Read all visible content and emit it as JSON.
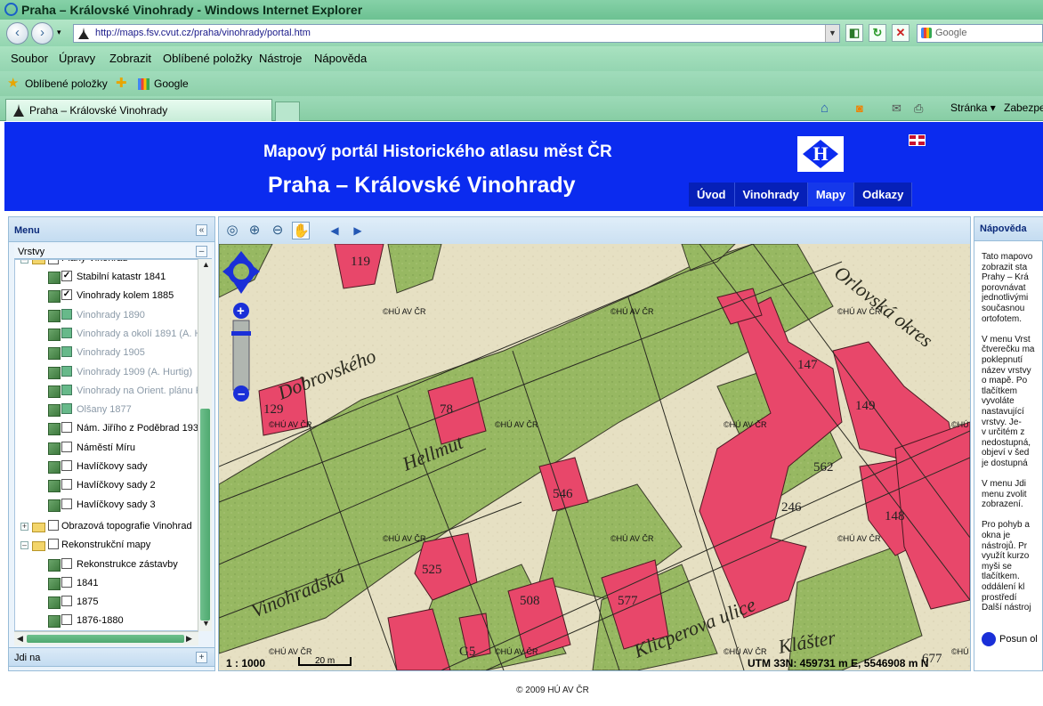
{
  "window": {
    "title": "Praha – Královské Vinohrady - Windows Internet Explorer"
  },
  "nav": {
    "url": "http://maps.fsv.cvut.cz/praha/vinohrady/portal.htm",
    "search_placeholder": "Google"
  },
  "menubar": [
    "Soubor",
    "Úpravy",
    "Zobrazit",
    "Oblíbené položky",
    "Nástroje",
    "Nápověda"
  ],
  "favbar": {
    "favorites": "Oblíbené položky",
    "google": "Google"
  },
  "tabbar": {
    "active_tab": "Praha – Královské Vinohrady",
    "page_menu": "Stránka",
    "safety_menu": "Zabezpe"
  },
  "page": {
    "title1": "Mapový portál Historického atlasu měst ČR",
    "title2": "Praha – Královské Vinohrady",
    "logo_letter": "H",
    "tabs": [
      {
        "label": "Úvod",
        "active": false
      },
      {
        "label": "Vinohrady",
        "active": false
      },
      {
        "label": "Mapy",
        "active": true
      },
      {
        "label": "Odkazy",
        "active": false
      }
    ],
    "footer": "© 2009 HÚ AV ČR"
  },
  "left": {
    "menu_title": "Menu",
    "collapse_btn": "«",
    "layers_title": "Vrstvy",
    "layers_btn": "–",
    "goto_title": "Jdi na",
    "goto_btn": "+",
    "top_partial": "Plány Vinohrad",
    "layers": [
      {
        "label": "Stabilní katastr 1841",
        "checked": true,
        "enabled": true
      },
      {
        "label": "Vinohrady kolem 1885",
        "checked": true,
        "enabled": true
      },
      {
        "label": "Vinohrady 1890",
        "checked": false,
        "enabled": false
      },
      {
        "label": "Vinohrady a okolí 1891 (A. H",
        "checked": false,
        "enabled": false
      },
      {
        "label": "Vinohrady 1905",
        "checked": false,
        "enabled": false
      },
      {
        "label": "Vinohrady 1909 (A. Hurtig)",
        "checked": false,
        "enabled": false
      },
      {
        "label": "Vinohrady na Orient. plánu P",
        "checked": false,
        "enabled": false
      },
      {
        "label": "Olšany 1877",
        "checked": false,
        "enabled": false
      },
      {
        "label": "Nám. Jiřího z Poděbrad 1932",
        "checked": false,
        "enabled": true
      },
      {
        "label": "Náměstí Míru",
        "checked": false,
        "enabled": true
      },
      {
        "label": "Havlíčkovy sady",
        "checked": false,
        "enabled": true
      },
      {
        "label": "Havlíčkovy sady 2",
        "checked": false,
        "enabled": true
      },
      {
        "label": "Havlíčkovy sady 3",
        "checked": false,
        "enabled": true
      }
    ],
    "groups": [
      {
        "label": "Obrazová topografie Vinohrad"
      },
      {
        "label": "Rekonstrukční mapy"
      }
    ],
    "recon_layers": [
      {
        "label": "Rekonstrukce zástavby"
      },
      {
        "label": "1841"
      },
      {
        "label": "1875"
      },
      {
        "label": "1876-1880"
      }
    ]
  },
  "map": {
    "watermark": "©HÚ AV ČR",
    "scale": "1 : 1000",
    "scale_bar": "20 m",
    "coords": "UTM 33N: 459731 m E, 5546908 m N",
    "parcels": [
      "119",
      "129",
      "78",
      "546",
      "525",
      "508",
      "577",
      "147",
      "149",
      "562",
      "246",
      "148",
      "677",
      "G5"
    ],
    "street_labels": [
      "Dobrovského",
      "Hellmut",
      "Vinohradská",
      "Orlovská okres",
      "Klicperova ulice",
      "Klášter"
    ],
    "colors": {
      "paper": "#e5dfbf",
      "green": "#97b862",
      "red": "#e8476a"
    }
  },
  "help": {
    "title": "Nápověda",
    "text": "Tato mapovo\nzobrazit sta\nPrahy – Krá\nporovnávat \njednotlivými\nsoučasnou \nortofotem.\n\nV menu Vrst\nčtverečku ma\npoklepnutí \nnázev vrstvy\no mapě. Po\ntlačítkem\nvyvoláte\nnastavující\nvrstvy. Je-\nv určitém z\nnedostupná,\nobjeví v šed\nje dostupná\n\nV menu Jdi \nmenu zvolit\nzobrazení.\n\nPro pohyb a\nokna je \nnástrojů. Pr\nvyužít kurzo\nmyši se \ntlačítkem.\noddálení kl\nprostředí \nDalší nástroj",
    "posun": "Posun ol"
  }
}
